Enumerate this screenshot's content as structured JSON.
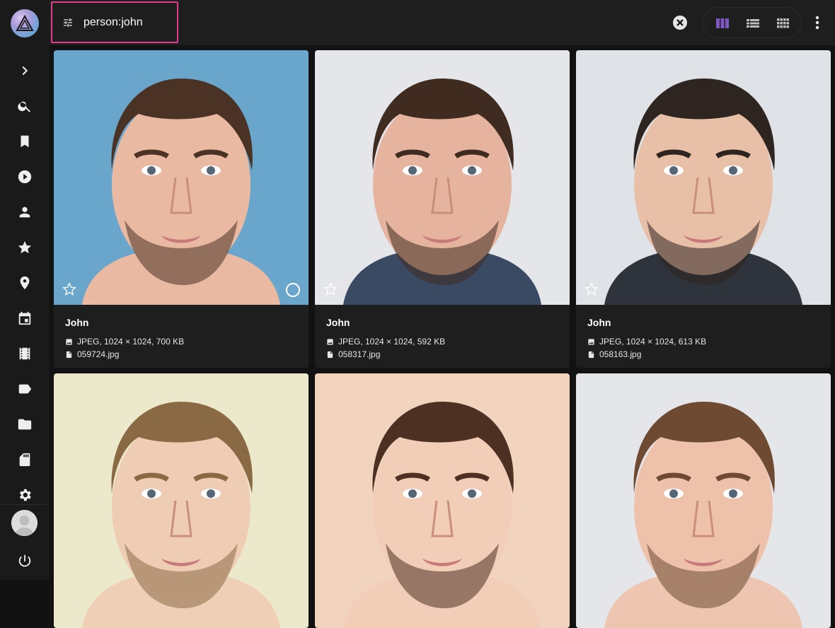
{
  "search": {
    "value": "person:john"
  },
  "sidebar": {
    "items": [
      {
        "name": "expand",
        "icon": "chevron-right-icon"
      },
      {
        "name": "search",
        "icon": "search-icon"
      },
      {
        "name": "albums",
        "icon": "bookmark-icon"
      },
      {
        "name": "videos",
        "icon": "play-circle-icon"
      },
      {
        "name": "people",
        "icon": "person-icon"
      },
      {
        "name": "favorites",
        "icon": "star-icon"
      },
      {
        "name": "places",
        "icon": "location-pin-icon"
      },
      {
        "name": "calendar",
        "icon": "calendar-icon"
      },
      {
        "name": "moments",
        "icon": "film-icon"
      },
      {
        "name": "labels",
        "icon": "label-icon"
      },
      {
        "name": "folders",
        "icon": "folder-icon"
      },
      {
        "name": "library",
        "icon": "sd-card-icon"
      },
      {
        "name": "settings",
        "icon": "gear-icon"
      },
      {
        "name": "logout",
        "icon": "power-icon"
      }
    ]
  },
  "toolbar": {
    "views": [
      "cards-view-icon",
      "list-view-icon",
      "mosaic-view-icon"
    ],
    "active_view": "cards",
    "accent": "#7e57c2"
  },
  "photos": [
    {
      "title": "John",
      "details": "JPEG, 1024 × 1024, 700 KB",
      "file": "059724.jpg",
      "bg": "#6aa6cc",
      "skin": "#e9b9a2",
      "hair": "#4a3225"
    },
    {
      "title": "John",
      "details": "JPEG, 1024 × 1024, 592 KB",
      "file": "058317.jpg",
      "bg": "#e4e6ea",
      "skin": "#e6b49e",
      "hair": "#3f2b20"
    },
    {
      "title": "John",
      "details": "JPEG, 1024 × 1024, 613 KB",
      "file": "058163.jpg",
      "bg": "#dfe2e6",
      "skin": "#e8c0a8",
      "hair": "#2e2520"
    },
    {
      "title": "",
      "details": "",
      "file": "",
      "bg": "#ece8cc",
      "skin": "#efcdb5",
      "hair": "#8a6a45"
    },
    {
      "title": "",
      "details": "",
      "file": "",
      "bg": "#f2d3bd",
      "skin": "#f2cdb8",
      "hair": "#4d3022"
    },
    {
      "title": "",
      "details": "",
      "file": "",
      "bg": "#e4e6ea",
      "skin": "#eec1aa",
      "hair": "#6e4a33"
    }
  ],
  "colors": {
    "highlight_border": "#e33d8f"
  }
}
